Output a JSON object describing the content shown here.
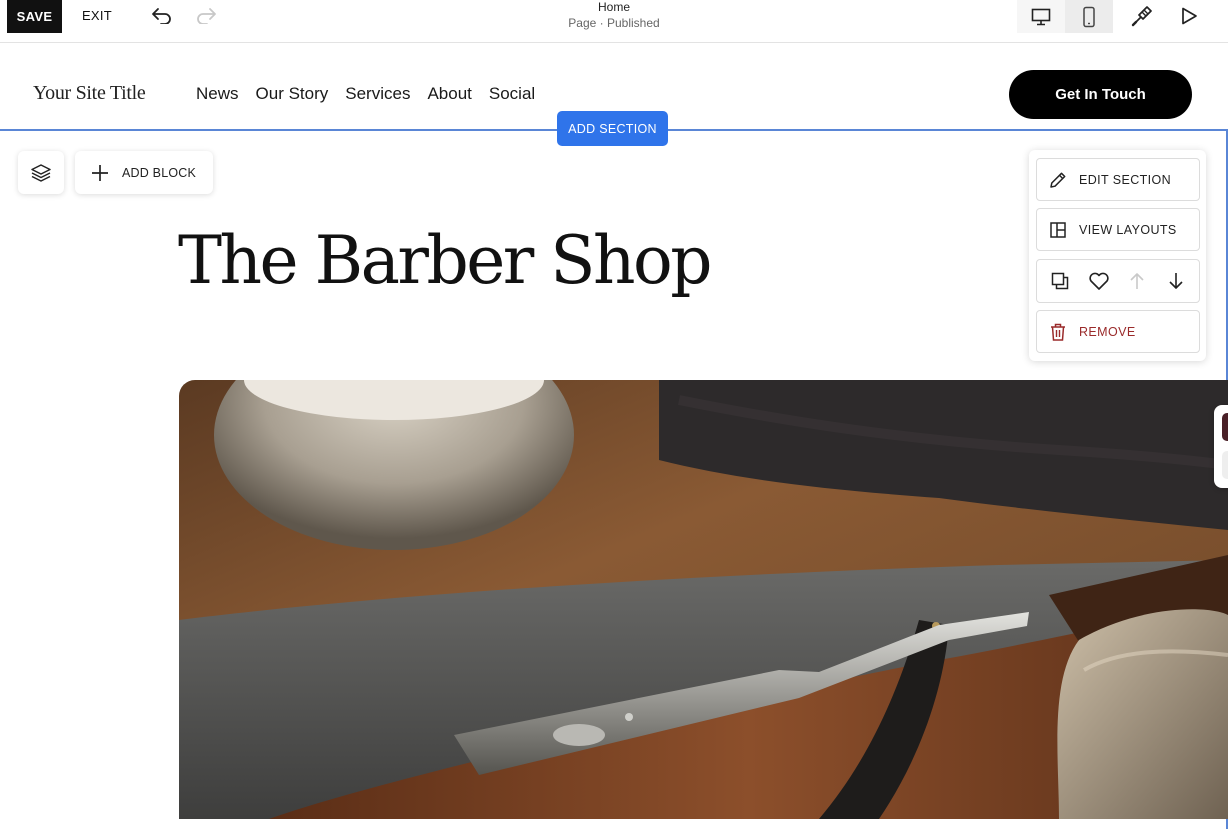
{
  "toolbar": {
    "save_label": "SAVE",
    "exit_label": "EXIT",
    "page_name": "Home",
    "page_status": "Page · Published",
    "undo_icon": "undo-icon",
    "redo_icon": "redo-icon",
    "device_modes": [
      "desktop-icon",
      "mobile-icon"
    ],
    "active_device": "mobile",
    "design_icon": "paintbrush-icon",
    "preview_icon": "play-icon"
  },
  "site_header": {
    "title": "Your Site Title",
    "nav": [
      "News",
      "Our Story",
      "Services",
      "About",
      "Social"
    ],
    "cta_label": "Get In Touch"
  },
  "editor": {
    "add_section_label": "ADD SECTION",
    "add_block_label": "ADD BLOCK",
    "layers_icon": "layers-icon"
  },
  "section": {
    "heading": "The Barber Shop"
  },
  "section_panel": {
    "edit_section_label": "EDIT SECTION",
    "view_layouts_label": "VIEW LAYOUTS",
    "remove_label": "REMOVE",
    "row_icons": [
      "duplicate-icon",
      "heart-icon",
      "arrow-up-icon",
      "arrow-down-icon"
    ],
    "remove_color": "#9a2a2a"
  },
  "colors": {
    "accent": "#2f74ea",
    "selection_outline": "#5a86d6",
    "button_dark": "#000000"
  }
}
